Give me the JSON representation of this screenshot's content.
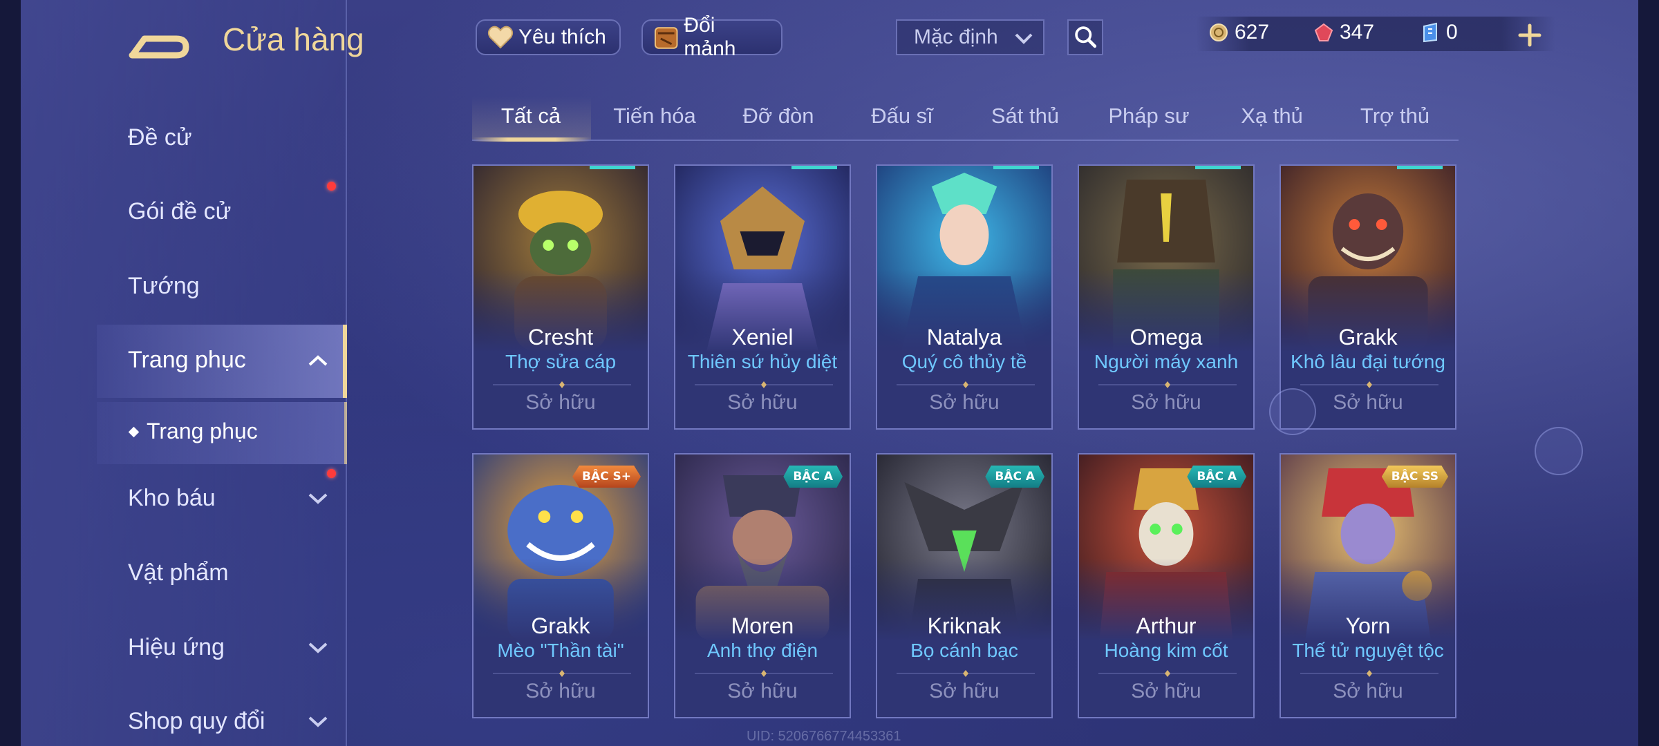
{
  "store": {
    "title": "Cửa hàng"
  },
  "sidebar": {
    "items": [
      {
        "label": "Đề cử",
        "dot": false,
        "chevron": "none"
      },
      {
        "label": "Gói đề cử",
        "dot": true,
        "chevron": "none"
      },
      {
        "label": "Tướng",
        "dot": false,
        "chevron": "none"
      },
      {
        "label": "Trang phục",
        "dot": false,
        "chevron": "up",
        "active": true
      },
      {
        "label": "Kho báu",
        "dot": true,
        "chevron": "down"
      },
      {
        "label": "Vật phẩm",
        "dot": false,
        "chevron": "none"
      },
      {
        "label": "Hiệu ứng",
        "dot": false,
        "chevron": "down"
      },
      {
        "label": "Shop quy đổi",
        "dot": false,
        "chevron": "down"
      }
    ],
    "sub_item": "Trang phục"
  },
  "topbar": {
    "favorite_label": "Yêu thích",
    "exchange_label": "Đổi mảnh",
    "sort_value": "Mặc định",
    "currencies": [
      {
        "icon": "coin-icon",
        "value": "627"
      },
      {
        "icon": "ruby-icon",
        "value": "347"
      },
      {
        "icon": "voucher-icon",
        "value": "0"
      }
    ]
  },
  "tabs": [
    "Tất cả",
    "Tiến hóa",
    "Đỡ đòn",
    "Đấu sĩ",
    "Sát thủ",
    "Pháp sư",
    "Xạ thủ",
    "Trợ thủ"
  ],
  "active_tab": "Tất cả",
  "cards": [
    {
      "hero": "Cresht",
      "skin": "Thợ sửa cáp",
      "status": "Sở hữu",
      "badge": ""
    },
    {
      "hero": "Xeniel",
      "skin": "Thiên sứ hủy diệt",
      "status": "Sở hữu",
      "badge": ""
    },
    {
      "hero": "Natalya",
      "skin": "Quý cô thủy tề",
      "status": "Sở hữu",
      "badge": ""
    },
    {
      "hero": "Omega",
      "skin": "Người máy xanh",
      "status": "Sở hữu",
      "badge": ""
    },
    {
      "hero": "Grakk",
      "skin": "Khô lâu đại tướng",
      "status": "Sở hữu",
      "badge": ""
    },
    {
      "hero": "Grakk",
      "skin": "Mèo \"Thần tài\"",
      "status": "Sở hữu",
      "badge": "BẬC S+"
    },
    {
      "hero": "Moren",
      "skin": "Anh thợ điện",
      "status": "Sở hữu",
      "badge": "BẬC A"
    },
    {
      "hero": "Kriknak",
      "skin": "Bọ cánh bạc",
      "status": "Sở hữu",
      "badge": "BẬC A"
    },
    {
      "hero": "Arthur",
      "skin": "Hoàng kim cốt",
      "status": "Sở hữu",
      "badge": "BẬC A"
    },
    {
      "hero": "Yorn",
      "skin": "Thế tử nguyệt tộc",
      "status": "Sở hữu",
      "badge": "BẬC SS"
    }
  ],
  "uid_text": "UID: 5206766774453361",
  "colors": {
    "accent_gold": "#f0d79a",
    "skin_name": "#6fc8ff",
    "badge_a": "#27b8b5",
    "badge_splus": "#f28a3e",
    "badge_ss": "#f2c85a",
    "notification_dot": "#ff3b3b"
  }
}
